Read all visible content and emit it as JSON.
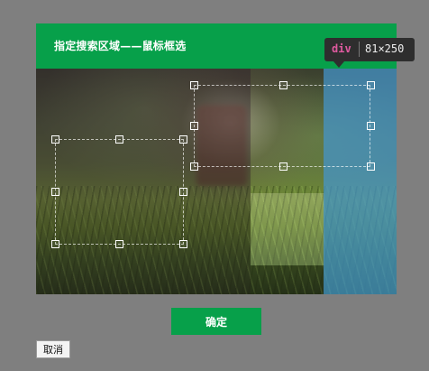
{
  "dialog": {
    "title": "指定搜索区域——鼠标框选"
  },
  "inspector_tooltip": {
    "tag": "div",
    "dimensions": "81×250"
  },
  "actions": {
    "confirm_label": "确定",
    "cancel_label": "取消"
  },
  "colors": {
    "header_green": "#07a04a",
    "selection_overlay_blue": "#4496cd",
    "backdrop_gray": "#7f7f7f"
  }
}
